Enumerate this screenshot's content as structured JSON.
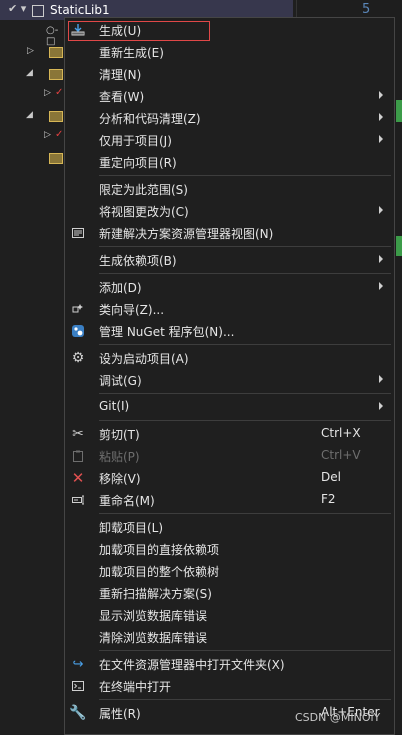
{
  "background": {
    "project_title": "StaticLib1",
    "line_number": "5"
  },
  "menu": {
    "items": [
      {
        "label": "生成(U)"
      },
      {
        "label": "重新生成(E)"
      },
      {
        "label": "清理(N)"
      },
      {
        "label": "查看(W)"
      },
      {
        "label": "分析和代码清理(Z)"
      },
      {
        "label": "仅用于项目(J)"
      },
      {
        "label": "重定向项目(R)"
      },
      {
        "label": "限定为此范围(S)"
      },
      {
        "label": "将视图更改为(C)"
      },
      {
        "label": "新建解决方案资源管理器视图(N)"
      },
      {
        "label": "生成依赖项(B)"
      },
      {
        "label": "添加(D)"
      },
      {
        "label": "类向导(Z)..."
      },
      {
        "label": "管理 NuGet 程序包(N)..."
      },
      {
        "label": "设为启动项目(A)"
      },
      {
        "label": "调试(G)"
      },
      {
        "label": "Git(I)"
      },
      {
        "label": "剪切(T)",
        "shortcut": "Ctrl+X"
      },
      {
        "label": "粘贴(P)",
        "shortcut": "Ctrl+V"
      },
      {
        "label": "移除(V)",
        "shortcut": "Del"
      },
      {
        "label": "重命名(M)",
        "shortcut": "F2"
      },
      {
        "label": "卸载项目(L)"
      },
      {
        "label": "加载项目的直接依赖项"
      },
      {
        "label": "加载项目的整个依赖树"
      },
      {
        "label": "重新扫描解决方案(S)"
      },
      {
        "label": "显示浏览数据库错误"
      },
      {
        "label": "清除浏览数据库错误"
      },
      {
        "label": "在文件资源管理器中打开文件夹(X)"
      },
      {
        "label": "在终端中打开"
      },
      {
        "label": "属性(R)",
        "shortcut": "Alt+Enter"
      }
    ]
  },
  "watermark": "CSDN @MINOiY",
  "colors": {
    "menu_bg": "#1f1f1f",
    "highlight_border": "#e04848",
    "header_bg": "#37374d",
    "remove_icon": "#e05050",
    "build_icon": "#4aa0e8"
  }
}
